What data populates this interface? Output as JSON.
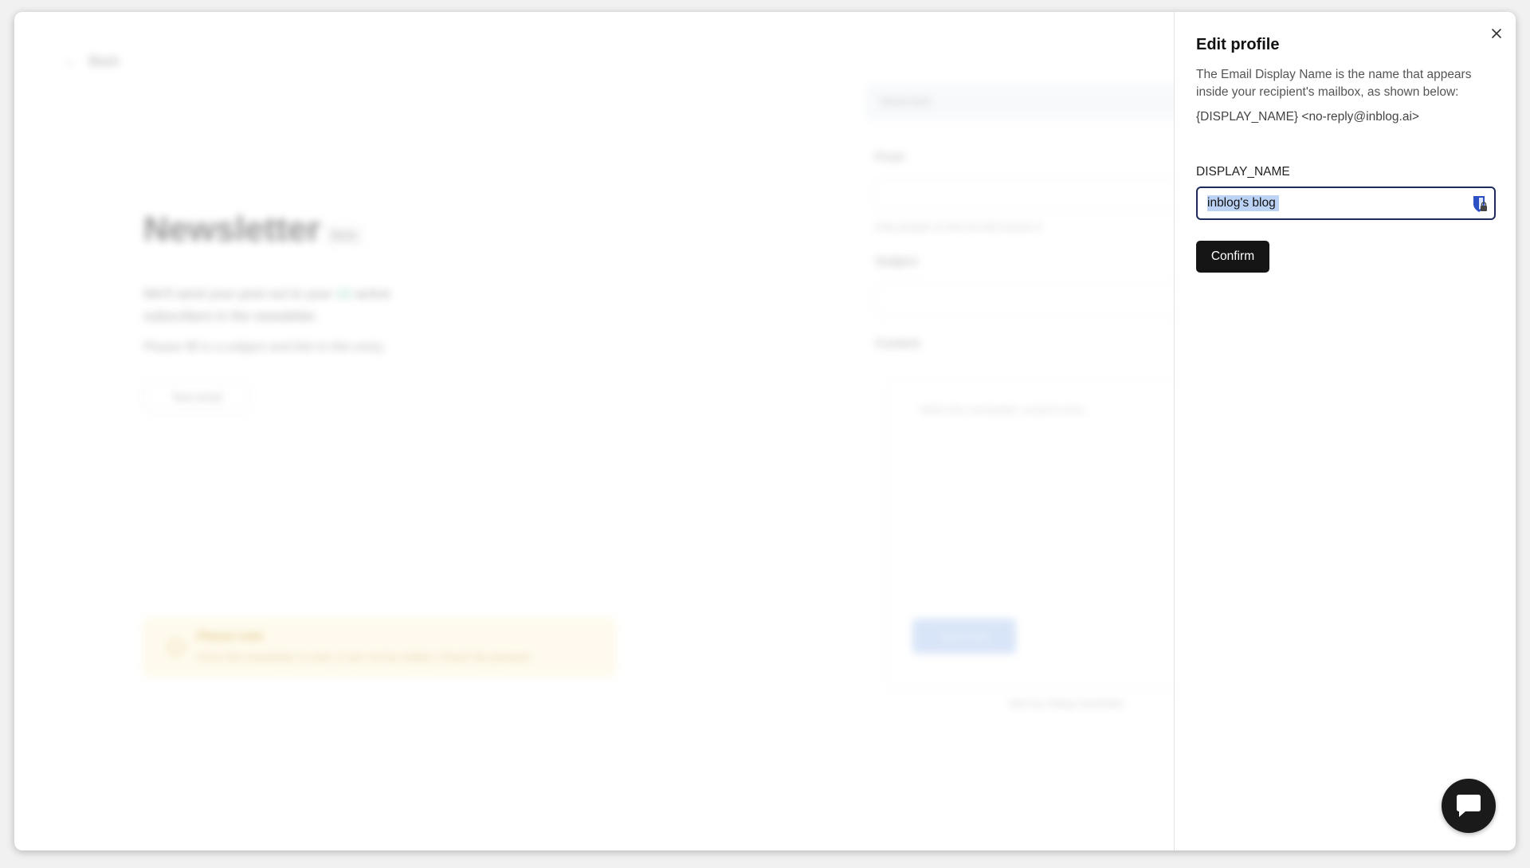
{
  "background": {
    "back_label": "Back",
    "title": "Newsletter",
    "badge": "Beta",
    "desc_before": "We'll send your post out to your",
    "desc_accent": "12",
    "desc_after": "active subscribers in the newsletter.",
    "hint": "Please fill in a subject and link to this entry.",
    "secondary_button": "Test email",
    "warning_title": "Please note",
    "warning_body": "Once the newsletter is sent, it can not be edited. Check the preview.",
    "send_bar": "Send test",
    "from_label": "From",
    "from_hint": "Only people on this list will receive it.",
    "subject_label": "Subject",
    "content_label": "Content",
    "editor_placeholder": "Write the newsletter content here.",
    "editor_button": "Send now",
    "footer_note": "Sent by inblog newsletter"
  },
  "panel": {
    "title": "Edit profile",
    "description": "The Email Display Name is the name that appears inside your recipient's mailbox, as shown below:",
    "example": "{DISPLAY_NAME} <no-reply@inblog.ai>",
    "field_label": "DISPLAY_NAME",
    "field_value": "inblog's blog",
    "confirm_label": "Confirm"
  },
  "colors": {
    "field_border": "#1d2b5a",
    "confirm_bg": "#151515",
    "selection": "#bcd3f5",
    "password_icon": "#2c4fc4"
  },
  "icons": {
    "close": "close-icon",
    "password_manager": "password-manager-icon",
    "chat": "chat-icon"
  }
}
